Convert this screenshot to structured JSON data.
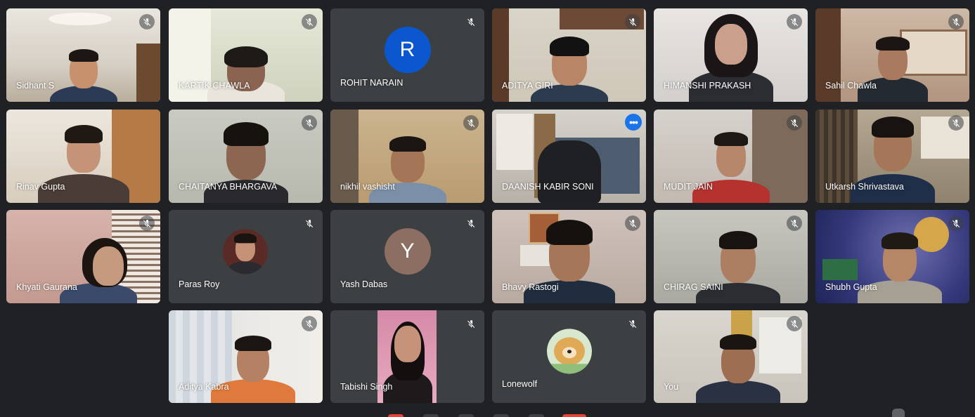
{
  "participants": [
    {
      "name": "Sidhant S",
      "video": true,
      "muted": true
    },
    {
      "name": "KARTIK CHAWLA",
      "video": true,
      "muted": true
    },
    {
      "name": "ROHIT NARAIN",
      "video": false,
      "muted": true,
      "avatar_letter": "R",
      "avatar_color": "#0b57d0"
    },
    {
      "name": "ADITYA GIRI",
      "video": true,
      "muted": true
    },
    {
      "name": "HIMANSHI PRAKASH",
      "video": true,
      "muted": true
    },
    {
      "name": "Sahil Chawla",
      "video": true,
      "muted": true
    },
    {
      "name": "Rinav Gupta",
      "video": true,
      "muted": false
    },
    {
      "name": "CHAITANYA BHARGAVA",
      "video": true,
      "muted": true
    },
    {
      "name": "nikhil vashisht",
      "video": true,
      "muted": true
    },
    {
      "name": "DAANISH KABIR SONI",
      "video": true,
      "muted": false,
      "active": true
    },
    {
      "name": "MUDIT JAIN",
      "video": true,
      "muted": true
    },
    {
      "name": "Utkarsh Shrivastava",
      "video": true,
      "muted": true
    },
    {
      "name": "Khyati Gaurana",
      "video": true,
      "muted": true
    },
    {
      "name": "Paras Roy",
      "video": false,
      "muted": true,
      "avatar": "photo"
    },
    {
      "name": "Yash Dabas",
      "video": false,
      "muted": true,
      "avatar_letter": "Y",
      "avatar_color": "#8d6e63"
    },
    {
      "name": "Bhavy Rastogi",
      "video": true,
      "muted": true
    },
    {
      "name": "CHIRAG SAINI",
      "video": true,
      "muted": true
    },
    {
      "name": "Shubh Gupta",
      "video": true,
      "muted": true
    },
    {
      "name": "Aditya Kabra",
      "video": true,
      "muted": true
    },
    {
      "name": "Tabishi Singh",
      "video": true,
      "muted": true
    },
    {
      "name": "Lonewolf",
      "video": false,
      "muted": true,
      "avatar": "photo"
    },
    {
      "name": "You",
      "video": true,
      "muted": true
    }
  ],
  "icons": {
    "mic_off": "mic-off-icon",
    "more": "more-options-icon"
  },
  "colors": {
    "background": "#202124",
    "tile": "#3c4043",
    "active_border": "#8ab4f8"
  }
}
